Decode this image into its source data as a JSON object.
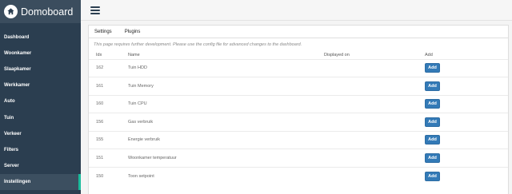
{
  "sidebar": {
    "brand": "Domoboard",
    "items": [
      {
        "label": "Dashboard",
        "active": false
      },
      {
        "label": "Woonkamer",
        "active": false
      },
      {
        "label": "Slaapkamer",
        "active": false
      },
      {
        "label": "Werkkamer",
        "active": false
      },
      {
        "label": "Auto",
        "active": false
      },
      {
        "label": "Tuin",
        "active": false
      },
      {
        "label": "Verkeer",
        "active": false
      },
      {
        "label": "Filters",
        "active": false
      },
      {
        "label": "Server",
        "active": false
      },
      {
        "label": "Instellingen",
        "active": true
      }
    ]
  },
  "topbar": {
    "menu_icon": "hamburger-icon"
  },
  "panel": {
    "tabs": [
      "Settings",
      "Plugins"
    ],
    "notice": "This page requires further development. Please use the config file for advanced changes to the dashboard.",
    "columns": [
      "Idx",
      "Name",
      "Displayed on",
      "Add"
    ],
    "rows": [
      {
        "idx": "162",
        "name": "Tuin HDD",
        "displayed_on": "",
        "add_label": "Add"
      },
      {
        "idx": "161",
        "name": "Tuin Memory",
        "displayed_on": "",
        "add_label": "Add"
      },
      {
        "idx": "160",
        "name": "Tuin CPU",
        "displayed_on": "",
        "add_label": "Add"
      },
      {
        "idx": "156",
        "name": "Gas verbruik",
        "displayed_on": "",
        "add_label": "Add"
      },
      {
        "idx": "155",
        "name": "Energie verbruik",
        "displayed_on": "",
        "add_label": "Add"
      },
      {
        "idx": "151",
        "name": "Woonkamer temperatuur",
        "displayed_on": "",
        "add_label": "Add"
      },
      {
        "idx": "150",
        "name": "Toon setpoint",
        "displayed_on": "",
        "add_label": "Add"
      }
    ]
  },
  "colors": {
    "sidebar": "#2b3e50",
    "accent": "#1abc9c",
    "button": "#337ab7"
  }
}
